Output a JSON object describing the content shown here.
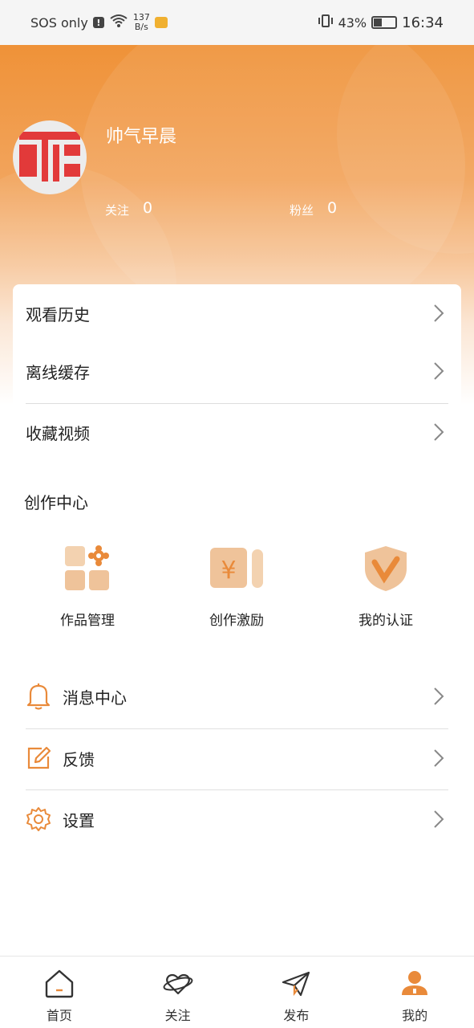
{
  "status_bar": {
    "carrier": "SOS only",
    "net_speed_top": "137",
    "net_speed_bottom": "B/s",
    "battery": "43%",
    "time": "16:34"
  },
  "profile": {
    "username": "帅气早晨",
    "following_label": "关注",
    "following_count": "0",
    "fans_label": "粉丝",
    "fans_count": "0"
  },
  "menu": {
    "items": [
      {
        "label": "观看历史"
      },
      {
        "label": "离线缓存"
      },
      {
        "label": "收藏视频"
      }
    ]
  },
  "creation": {
    "title": "创作中心",
    "tools": [
      {
        "label": "作品管理",
        "icon": "works-grid-icon"
      },
      {
        "label": "创作激励",
        "icon": "yen-coin-icon"
      },
      {
        "label": "我的认证",
        "icon": "verified-shield-icon"
      }
    ]
  },
  "settings_list": {
    "items": [
      {
        "label": "消息中心",
        "icon": "bell-icon"
      },
      {
        "label": "反馈",
        "icon": "edit-icon"
      },
      {
        "label": "设置",
        "icon": "gear-icon"
      }
    ]
  },
  "bottom_nav": {
    "items": [
      {
        "label": "首页",
        "icon": "home-icon"
      },
      {
        "label": "关注",
        "icon": "heart-planet-icon"
      },
      {
        "label": "发布",
        "icon": "paper-plane-icon"
      },
      {
        "label": "我的",
        "icon": "user-icon"
      }
    ]
  },
  "colors": {
    "accent": "#ef9238",
    "icon_orange": "#e98a3a"
  }
}
